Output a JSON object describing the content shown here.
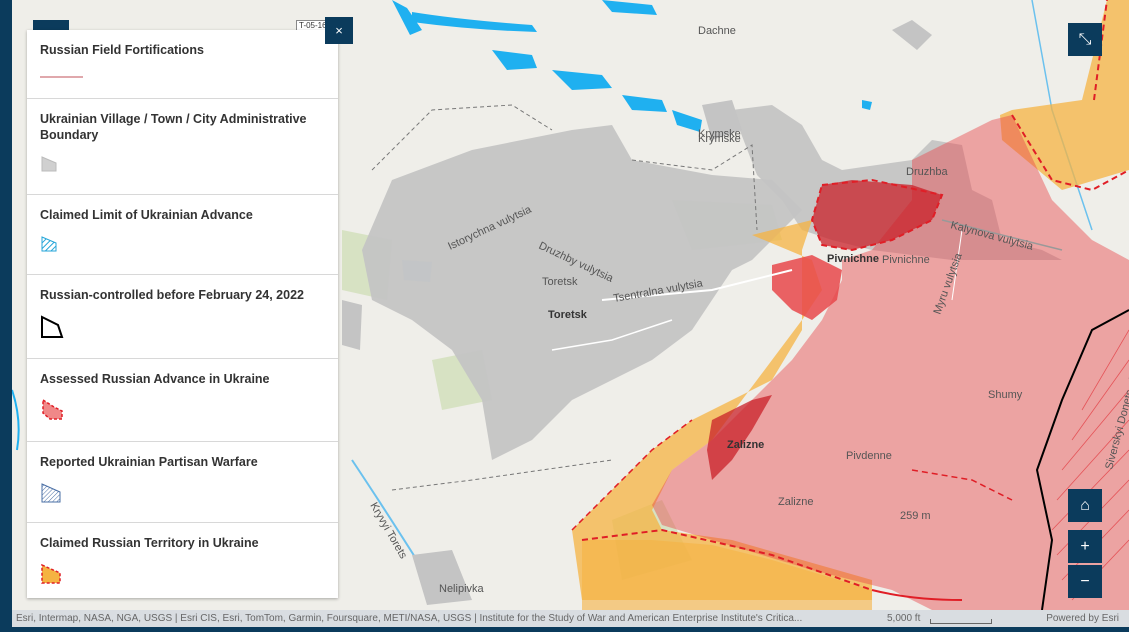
{
  "legend": {
    "items": [
      {
        "title": "Russian Field Fortifications"
      },
      {
        "title": "Ukrainian Village / Town / City Administrative Boundary"
      },
      {
        "title": "Claimed Limit of Ukrainian Advance"
      },
      {
        "title": "Russian-controlled before February 24, 2022"
      },
      {
        "title": "Assessed Russian Advance in Ukraine"
      },
      {
        "title": "Reported Ukrainian Partisan Warfare"
      },
      {
        "title": "Claimed Russian Territory in Ukraine"
      }
    ]
  },
  "controls": {
    "close_label": "×",
    "expand_label": "⤡",
    "home_label": "⌂",
    "zoom_in_label": "+",
    "zoom_out_label": "−"
  },
  "map_labels": {
    "dachne": "Dachne",
    "krymske1": "Krymske",
    "krymske2": "Krymske",
    "druzhba": "Druzhba",
    "toretsk1": "Toretsk",
    "toretsk2": "Toretsk",
    "pivnichne1": "Pivnichne",
    "pivnichne2": "Pivnichne",
    "zalizne1": "Zalizne",
    "zalizne2": "Zalizne",
    "pivdenne": "Pivdenne",
    "shumy": "Shumy",
    "nelipivka": "Nelipivka",
    "istorychna": "Istorychna vulytsia",
    "druzhby": "Druzhby vulytsia",
    "tsentralna": "Tsentralna vulytsia",
    "kalynova": "Kalynova vulytsia",
    "myru": "Myru vulytsia",
    "siverskyi": "Siverskyi Donets - Donbas",
    "kryvyi": "Kryvyi Torets",
    "elev": "259 m",
    "tag": "T-05-16"
  },
  "attribution": {
    "text": "Esri, Intermap, NASA, NGA, USGS | Esri CIS, Esri, TomTom, Garmin, Foursquare, METI/NASA, USGS | Institute for the Study of War and American Enterprise Institute's Critica...",
    "scale": "5,000 ft",
    "powered": "Powered by Esri"
  },
  "colors": {
    "russian_advance": "#e8484b",
    "claimed_russian": "#f5b342",
    "town_gray": "#c4c4c4",
    "panel_dark": "#0b3b5c"
  }
}
